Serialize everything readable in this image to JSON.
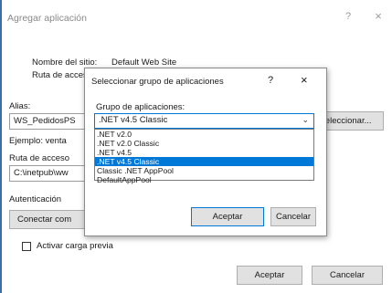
{
  "dialog": {
    "title": "Agregar aplicación",
    "help": "?",
    "close": "×",
    "site_name_label": "Nombre del sitio:",
    "site_name_value": "Default Web Site",
    "access_route_label": "Ruta de acces",
    "alias_label": "Alias:",
    "alias_value": "WS_PedidosPS",
    "select_button": "Seleccionar...",
    "example_label": "Ejemplo: venta",
    "physical_path_label": "Ruta de acceso",
    "physical_path_value": "C:\\inetpub\\ww",
    "auth_label": "Autenticación",
    "connect_button": "Conectar com",
    "preload_label": "Activar carga previa",
    "ok_button": "Aceptar",
    "cancel_button": "Cancelar"
  },
  "app_pool_dialog": {
    "title": "Seleccionar grupo de aplicaciones",
    "help": "?",
    "close": "×",
    "pool_label": "Grupo de aplicaciones:",
    "selected_value": ".NET v4.5 Classic",
    "chevron": "⌄",
    "options": [
      ".NET v2.0",
      ".NET v2.0 Classic",
      ".NET v4.5",
      ".NET v4.5 Classic",
      "Classic .NET AppPool",
      "DefaultAppPool"
    ],
    "selected_index": 3,
    "ok_button": "Aceptar",
    "cancel_button": "Cancelar"
  },
  "colors": {
    "accent": "#0078d7",
    "title_text": "#8a8a8a"
  }
}
